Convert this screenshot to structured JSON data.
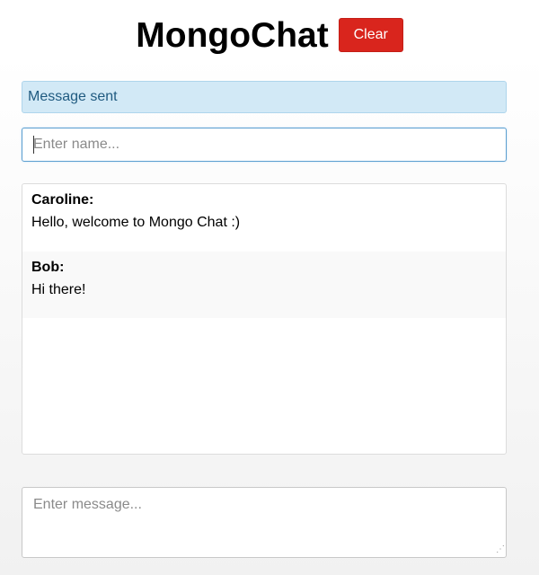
{
  "header": {
    "title": "MongoChat",
    "clear_label": "Clear"
  },
  "status": {
    "text": "Message sent"
  },
  "name_input": {
    "placeholder": "Enter name...",
    "value": ""
  },
  "messages": [
    {
      "author": "Caroline:",
      "text": "Hello, welcome to Mongo Chat :)"
    },
    {
      "author": "Bob:",
      "text": "Hi there!"
    }
  ],
  "message_input": {
    "placeholder": "Enter message...",
    "value": ""
  },
  "colors": {
    "clear_button": "#d9251d",
    "status_bg": "#d2e9f6",
    "status_text": "#1f5a80",
    "input_focus_border": "#5c9fd0"
  }
}
